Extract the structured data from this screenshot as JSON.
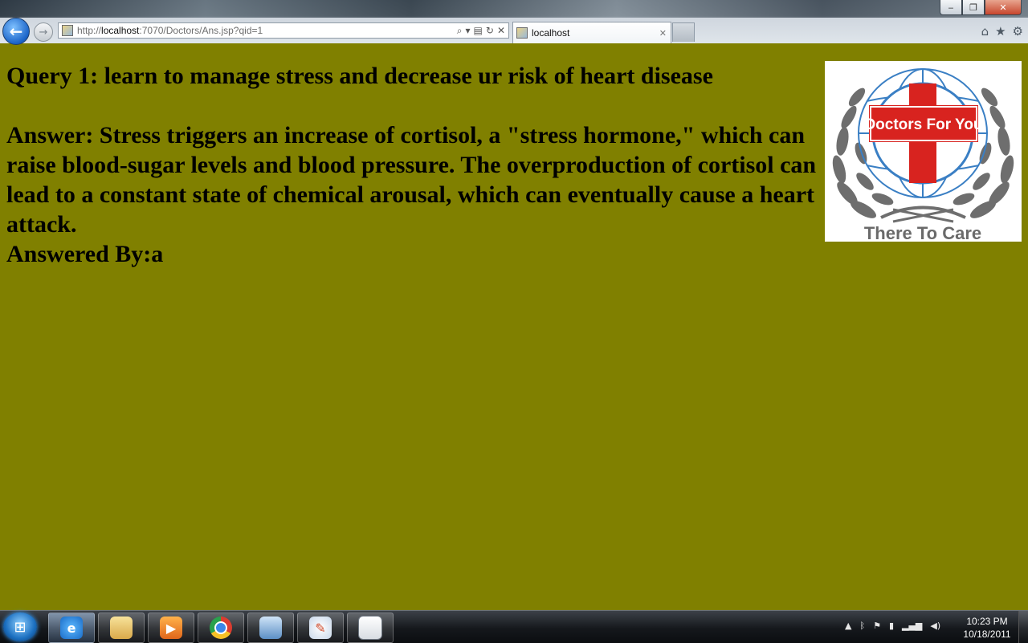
{
  "browser": {
    "url_prefix": "http://",
    "url_host": "localhost",
    "url_rest": ":7070/Doctors/Ans.jsp?qid=1",
    "tab_title": "localhost"
  },
  "page": {
    "query": "Query 1: learn to manage stress and decrease ur risk of heart disease",
    "answer": "Answer: Stress triggers an increase of cortisol, a \"stress hormone,\" which can raise blood-sugar levels and blood pressure. The overproduction of cortisol can lead to a constant state of chemical arousal, which can eventually cause a heart attack.",
    "answered_by": "Answered By:a"
  },
  "logo": {
    "brand": "Doctors For You",
    "tagline": "There To Care",
    "colors": {
      "cross": "#d8231f",
      "wreath": "#6e6e6e",
      "globe": "#3a7fc4",
      "tagline": "#6a6a6a"
    }
  },
  "taskbar": {
    "apps": [
      "internet-explorer-icon",
      "windows-explorer-icon",
      "media-player-icon",
      "chrome-icon",
      "virtualbox-icon",
      "paint-icon",
      "document-icon"
    ],
    "clock_time": "10:23 PM",
    "clock_date": "10/18/2011"
  },
  "colors": {
    "page_background": "#808000"
  }
}
